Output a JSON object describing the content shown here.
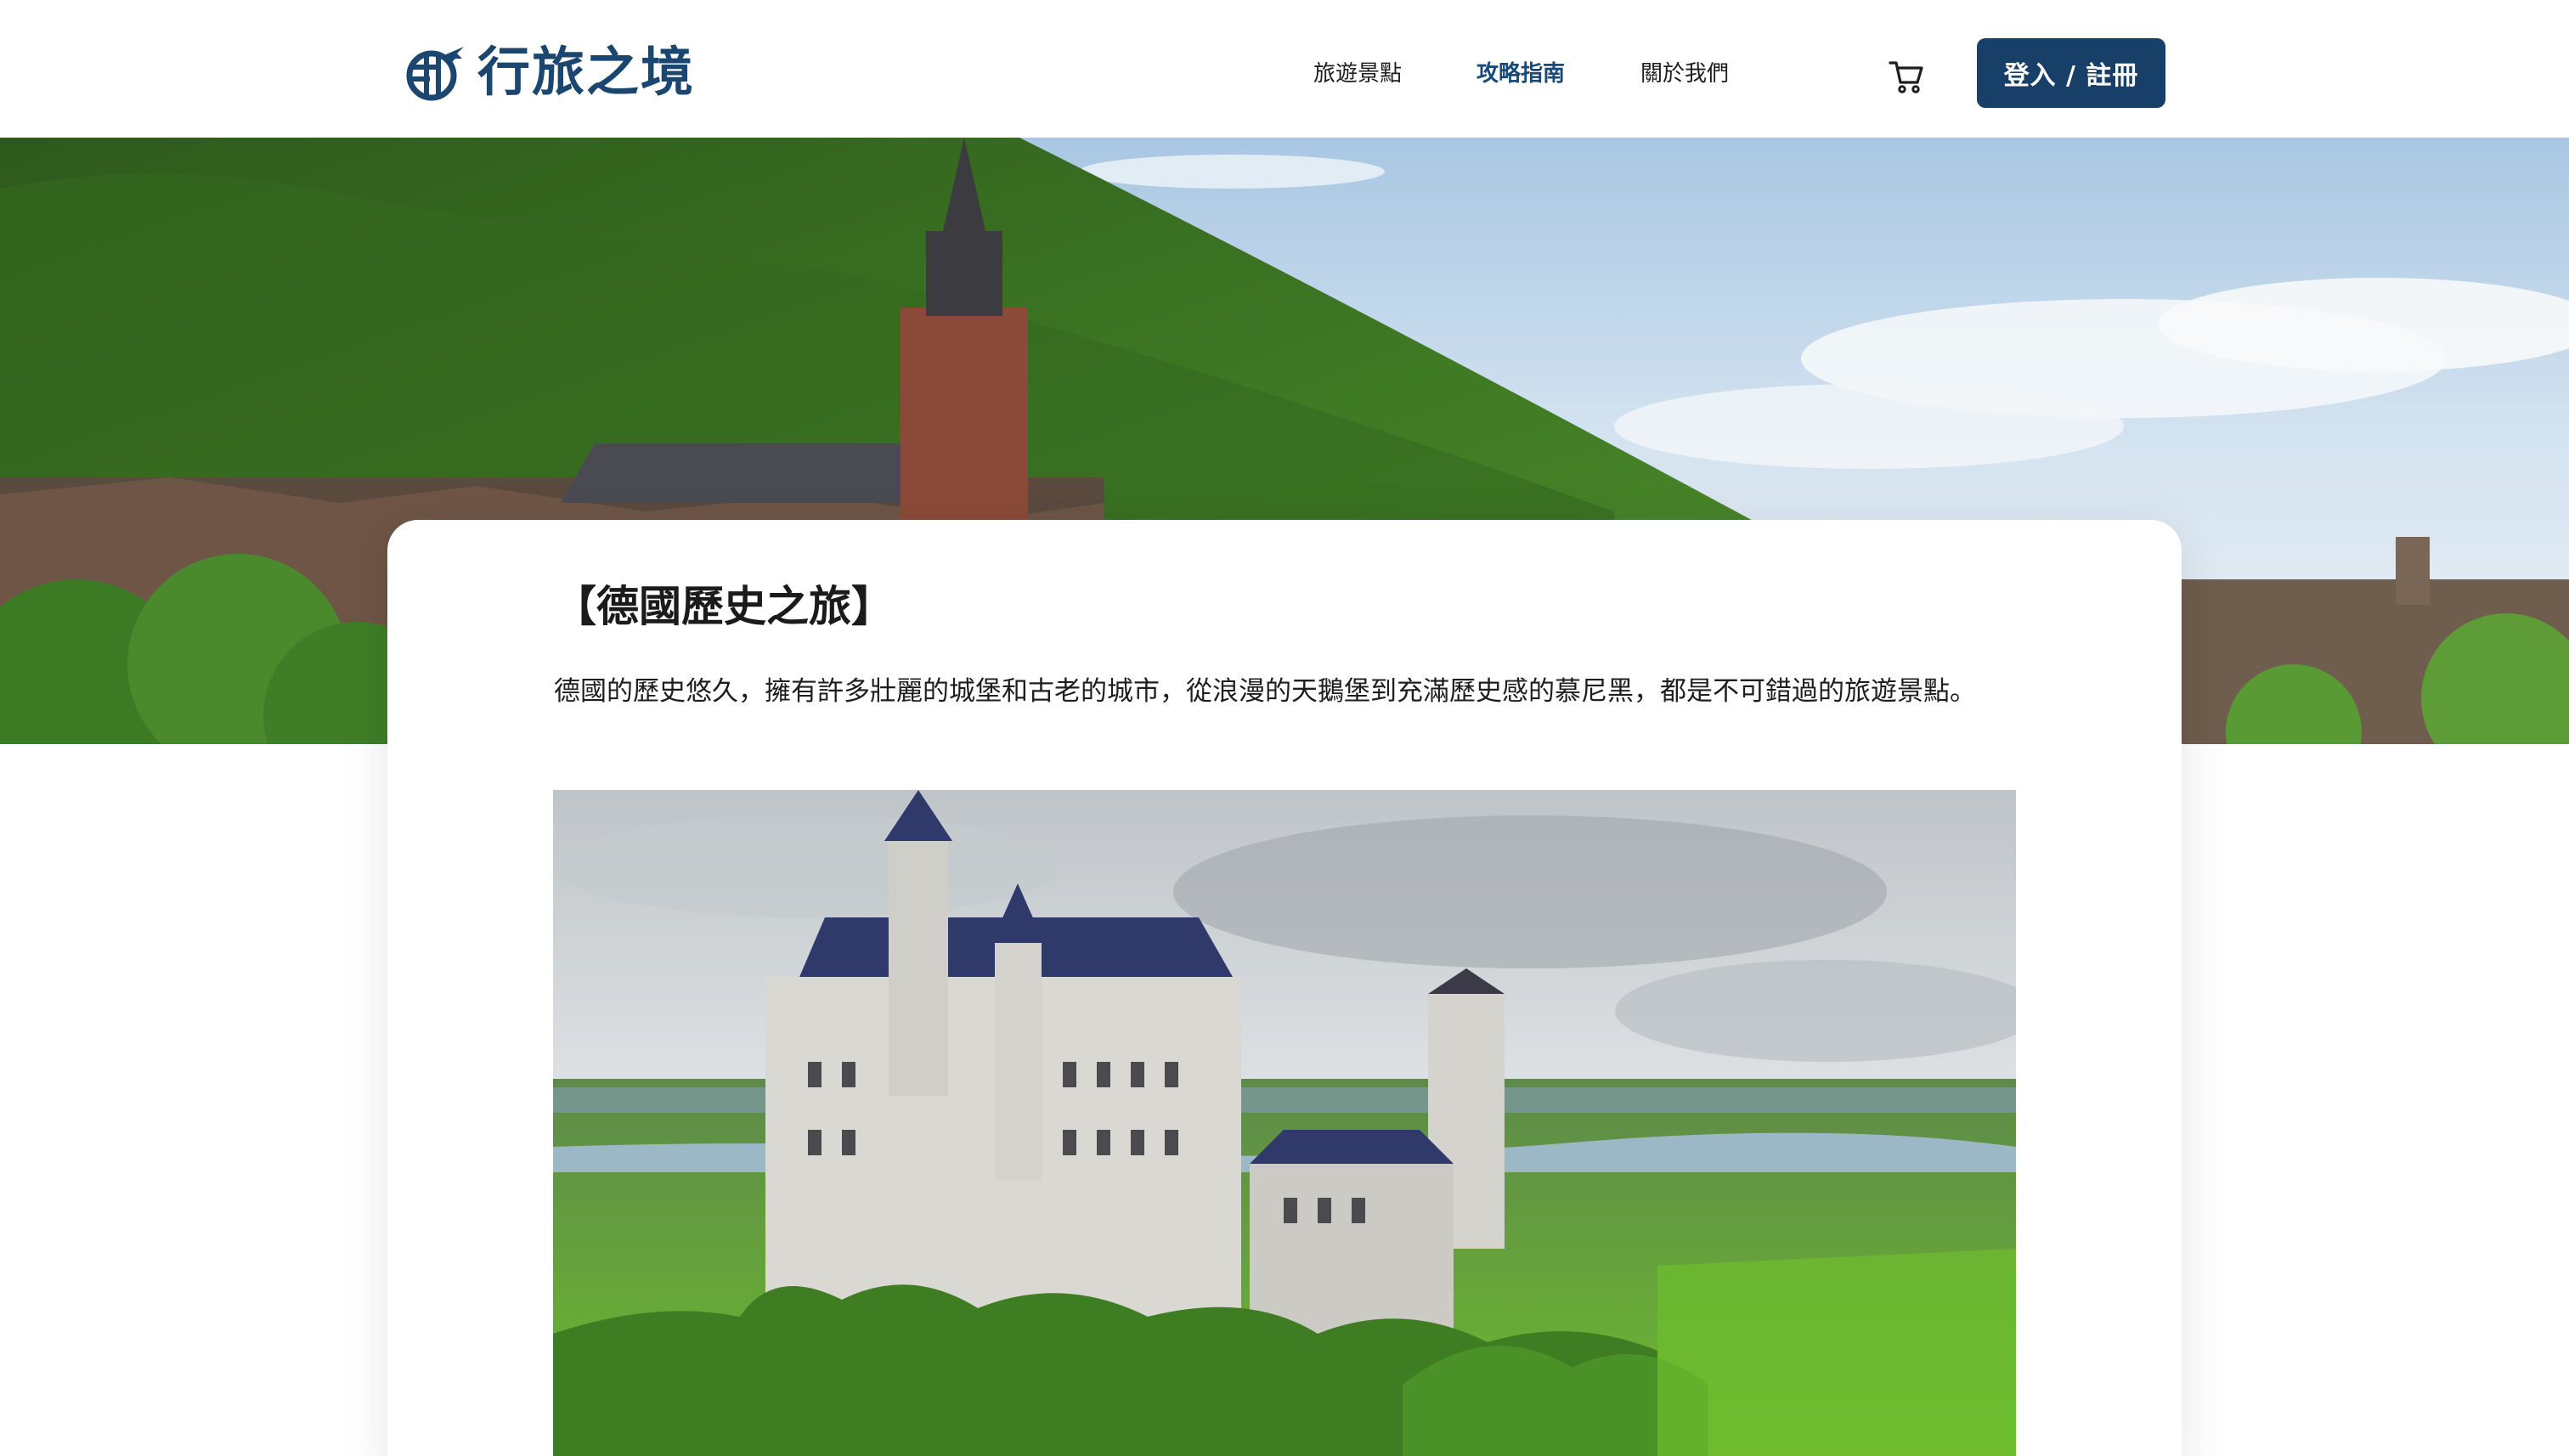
{
  "header": {
    "logo_text": "行旅之境",
    "logo_icon": "globe-plane-icon",
    "nav": [
      {
        "label": "旅遊景點",
        "active": false
      },
      {
        "label": "攻略指南",
        "active": true
      },
      {
        "label": "關於我們",
        "active": false
      }
    ],
    "cart_icon": "cart-icon",
    "login_label": "登入 / 註冊"
  },
  "hero": {
    "image_subject": "hillside-town-with-church-tower"
  },
  "article": {
    "title": "【德國歷史之旅】",
    "description": "德國的歷史悠久，擁有許多壯麗的城堡和古老的城市，從浪漫的天鵝堡到充滿歷史感的慕尼黑，都是不可錯過的旅遊景點。",
    "image_subject": "neuschwanstein-castle"
  },
  "colors": {
    "brand": "#173f68",
    "nav_active": "#174a78",
    "text": "#1e1e1e",
    "background": "#ffffff"
  }
}
